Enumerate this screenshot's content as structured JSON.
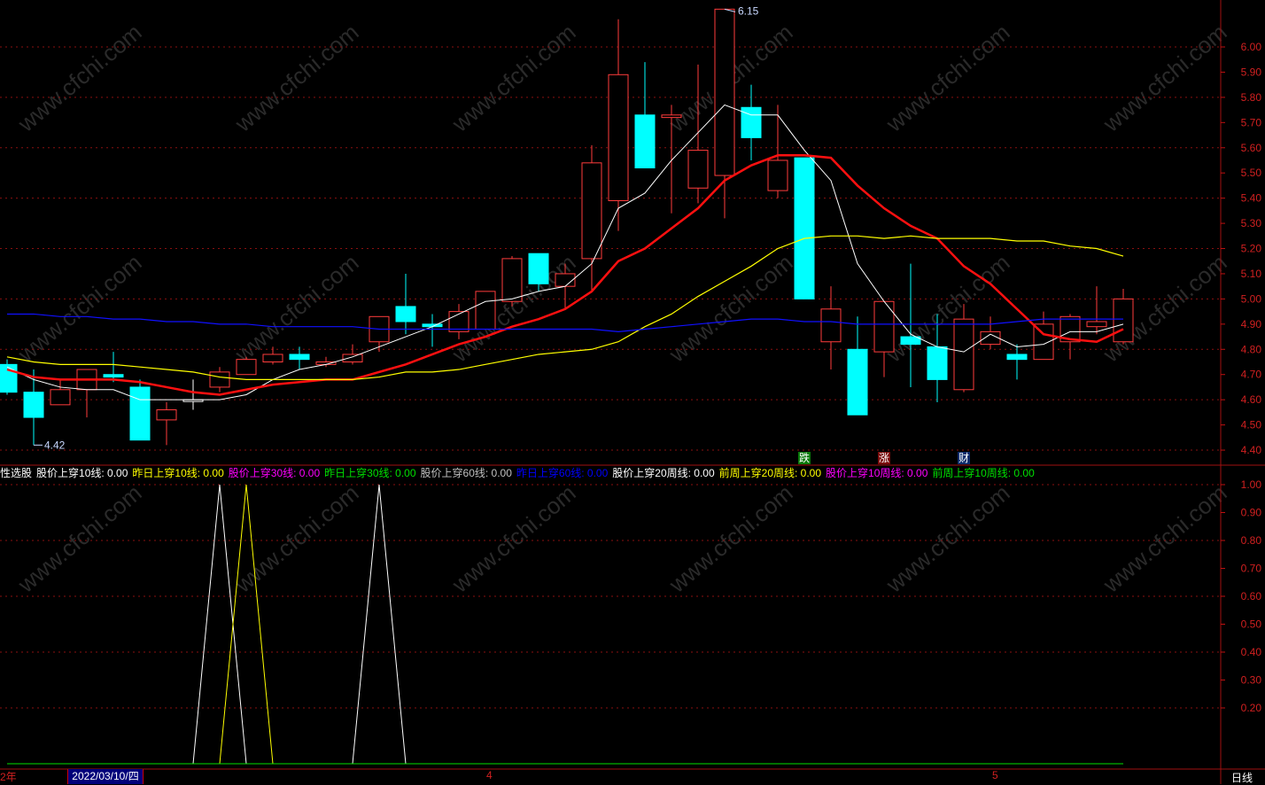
{
  "watermark": "www.cfchi.com",
  "price_label_high": "6.15",
  "price_label_low": "4.42",
  "badges": [
    {
      "text": "跌",
      "bg": "#0a7a0a",
      "idx": 30
    },
    {
      "text": "涨",
      "bg": "#7a0a0a",
      "idx": 33
    },
    {
      "text": "财",
      "bg": "#0a2a6a",
      "idx": 36
    }
  ],
  "legend": [
    {
      "text": "性选股",
      "color": "#ffffff"
    },
    {
      "text": "股价上穿10线: 0.00",
      "color": "#ffffff"
    },
    {
      "text": "昨日上穿10线: 0.00",
      "color": "#ffff00"
    },
    {
      "text": "股价上穿30线: 0.00",
      "color": "#ff00ff"
    },
    {
      "text": "昨日上穿30线: 0.00",
      "color": "#00e000"
    },
    {
      "text": "股价上穿60线: 0.00",
      "color": "#c0c0c0"
    },
    {
      "text": "昨日上穿60线: 0.00",
      "color": "#0000ff"
    },
    {
      "text": "股价上穿20周线: 0.00",
      "color": "#ffffff"
    },
    {
      "text": "前周上穿20周线: 0.00",
      "color": "#ffff00"
    },
    {
      "text": "股价上穿10周线: 0.00",
      "color": "#ff00ff"
    },
    {
      "text": "前周上穿10周线: 0.00",
      "color": "#00e000"
    }
  ],
  "xaxis": {
    "year": "2年",
    "selected_date": "2022/03/10/四",
    "month4": "4",
    "month5": "5",
    "period": "日线"
  },
  "chart_data": [
    {
      "type": "candlestick",
      "title": "price",
      "ylim": [
        4.36,
        6.17
      ],
      "yticks": [
        "6.00",
        "5.90",
        "5.80",
        "5.70",
        "5.60",
        "5.50",
        "5.40",
        "5.30",
        "5.20",
        "5.10",
        "5.00",
        "4.90",
        "4.80",
        "4.70",
        "4.60",
        "4.50",
        "4.40"
      ],
      "ohlc": [
        [
          4.74,
          4.76,
          4.62,
          4.63
        ],
        [
          4.63,
          4.72,
          4.42,
          4.53
        ],
        [
          4.58,
          4.68,
          4.58,
          4.64
        ],
        [
          4.64,
          4.72,
          4.53,
          4.72
        ],
        [
          4.7,
          4.79,
          4.67,
          4.69
        ],
        [
          4.65,
          4.68,
          4.44,
          4.44
        ],
        [
          4.52,
          4.59,
          4.42,
          4.56
        ],
        [
          4.6,
          4.68,
          4.56,
          4.6
        ],
        [
          4.65,
          4.73,
          4.63,
          4.71
        ],
        [
          4.7,
          4.77,
          4.7,
          4.76
        ],
        [
          4.75,
          4.81,
          4.74,
          4.78
        ],
        [
          4.78,
          4.81,
          4.72,
          4.76
        ],
        [
          4.74,
          4.77,
          4.73,
          4.75
        ],
        [
          4.75,
          4.82,
          4.74,
          4.78
        ],
        [
          4.83,
          4.93,
          4.79,
          4.93
        ],
        [
          4.97,
          5.1,
          4.86,
          4.91
        ],
        [
          4.9,
          4.94,
          4.81,
          4.89
        ],
        [
          4.87,
          4.98,
          4.84,
          4.95
        ],
        [
          4.88,
          5.03,
          4.88,
          5.03
        ],
        [
          4.99,
          5.17,
          4.97,
          5.16
        ],
        [
          5.18,
          5.18,
          5.03,
          5.06
        ],
        [
          5.05,
          5.14,
          4.96,
          5.1
        ],
        [
          5.16,
          5.61,
          5.03,
          5.54
        ],
        [
          5.39,
          6.11,
          5.27,
          5.89
        ],
        [
          5.73,
          5.94,
          5.52,
          5.52
        ],
        [
          5.72,
          5.77,
          5.34,
          5.73
        ],
        [
          5.44,
          5.93,
          5.38,
          5.59
        ],
        [
          5.49,
          6.15,
          5.32,
          6.15
        ],
        [
          5.76,
          5.85,
          5.55,
          5.64
        ],
        [
          5.43,
          5.77,
          5.4,
          5.55
        ],
        [
          5.56,
          5.56,
          5.0,
          5.0
        ],
        [
          4.83,
          5.05,
          4.72,
          4.96
        ],
        [
          4.8,
          4.93,
          4.54,
          4.54
        ],
        [
          4.79,
          4.99,
          4.69,
          4.99
        ],
        [
          4.85,
          5.14,
          4.65,
          4.82
        ],
        [
          4.81,
          4.94,
          4.59,
          4.68
        ],
        [
          4.64,
          4.98,
          4.63,
          4.92
        ],
        [
          4.82,
          4.93,
          4.8,
          4.87
        ],
        [
          4.78,
          4.82,
          4.68,
          4.76
        ],
        [
          4.76,
          4.95,
          4.76,
          4.9
        ],
        [
          4.83,
          4.94,
          4.76,
          4.93
        ],
        [
          4.89,
          5.05,
          4.86,
          4.91
        ],
        [
          4.83,
          5.04,
          4.82,
          5.0
        ]
      ],
      "series": [
        {
          "name": "MA5",
          "color": "#ffffff",
          "width": 1,
          "values": [
            4.73,
            4.68,
            4.65,
            4.64,
            4.64,
            4.6,
            4.6,
            4.6,
            4.6,
            4.62,
            4.68,
            4.72,
            4.74,
            4.77,
            4.81,
            4.85,
            4.89,
            4.94,
            4.99,
            5.0,
            5.03,
            5.05,
            5.14,
            5.36,
            5.42,
            5.55,
            5.66,
            5.77,
            5.73,
            5.73,
            5.59,
            5.47,
            5.14,
            4.99,
            4.86,
            4.81,
            4.79,
            4.86,
            4.81,
            4.82,
            4.87,
            4.87,
            4.9
          ]
        },
        {
          "name": "MA10",
          "color": "#ff1010",
          "width": 2.5,
          "values": [
            4.72,
            4.69,
            4.68,
            4.68,
            4.68,
            4.67,
            4.65,
            4.63,
            4.62,
            4.64,
            4.66,
            4.67,
            4.68,
            4.68,
            4.71,
            4.74,
            4.78,
            4.82,
            4.85,
            4.89,
            4.92,
            4.96,
            5.03,
            5.15,
            5.2,
            5.28,
            5.36,
            5.47,
            5.53,
            5.57,
            5.57,
            5.56,
            5.45,
            5.36,
            5.29,
            5.24,
            5.13,
            5.06,
            4.96,
            4.86,
            4.84,
            4.83,
            4.88
          ]
        },
        {
          "name": "MA30",
          "color": "#ffff00",
          "width": 1.2,
          "values": [
            4.77,
            4.75,
            4.74,
            4.74,
            4.74,
            4.73,
            4.72,
            4.71,
            4.69,
            4.68,
            4.68,
            4.68,
            4.68,
            4.68,
            4.69,
            4.71,
            4.71,
            4.72,
            4.74,
            4.76,
            4.78,
            4.79,
            4.8,
            4.83,
            4.89,
            4.94,
            5.01,
            5.07,
            5.13,
            5.2,
            5.24,
            5.25,
            5.25,
            5.24,
            5.25,
            5.24,
            5.24,
            5.24,
            5.23,
            5.23,
            5.21,
            5.2,
            5.17
          ]
        },
        {
          "name": "MA60",
          "color": "#1010ff",
          "width": 1.2,
          "values": [
            4.94,
            4.94,
            4.93,
            4.93,
            4.92,
            4.92,
            4.91,
            4.91,
            4.9,
            4.9,
            4.89,
            4.89,
            4.89,
            4.89,
            4.88,
            4.88,
            4.88,
            4.88,
            4.88,
            4.88,
            4.88,
            4.88,
            4.88,
            4.87,
            4.88,
            4.89,
            4.9,
            4.91,
            4.92,
            4.92,
            4.91,
            4.91,
            4.9,
            4.9,
            4.9,
            4.9,
            4.9,
            4.9,
            4.91,
            4.92,
            4.92,
            4.92,
            4.92
          ]
        }
      ]
    },
    {
      "type": "line",
      "title": "signals",
      "ylim": [
        0,
        1.05
      ],
      "yticks": [
        "1.00",
        "0.90",
        "0.80",
        "0.70",
        "0.60",
        "0.50",
        "0.40",
        "0.30",
        "0.20"
      ],
      "series": [
        {
          "name": "股价上穿10线",
          "color": "#ffffff",
          "nonzero": {
            "8": 1,
            "14": 1
          }
        },
        {
          "name": "昨日上穿10线",
          "color": "#ffff00",
          "nonzero": {
            "9": 1
          }
        },
        {
          "name": "前周上穿10周线",
          "color": "#00e000",
          "nonzero": {}
        }
      ]
    }
  ]
}
